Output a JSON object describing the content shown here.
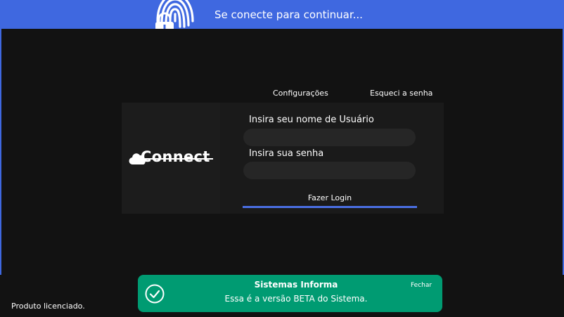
{
  "colors": {
    "header": "#3f68e0",
    "background": "#121212",
    "panel": "#1a1a1a",
    "input": "#262626",
    "accent": "#4a6fe3",
    "toast": "#009b72"
  },
  "header": {
    "icon": "fingerprint-icon",
    "title": "Se conecte para continuar..."
  },
  "links": {
    "settings": "Configurações",
    "forgot_password": "Esqueci a senha"
  },
  "logo": {
    "icon": "cloud-icon",
    "text": "Connect"
  },
  "form": {
    "username_label": "Insira seu nome de Usuário",
    "username_value": "",
    "password_label": "Insira sua senha",
    "password_value": "",
    "login_button": "Fazer Login"
  },
  "status": "Produto licenciado.",
  "toast": {
    "icon": "check-circle-icon",
    "title": "Sistemas Informa",
    "message": "Essa é a versão BETA do Sistema.",
    "close": "Fechar"
  }
}
